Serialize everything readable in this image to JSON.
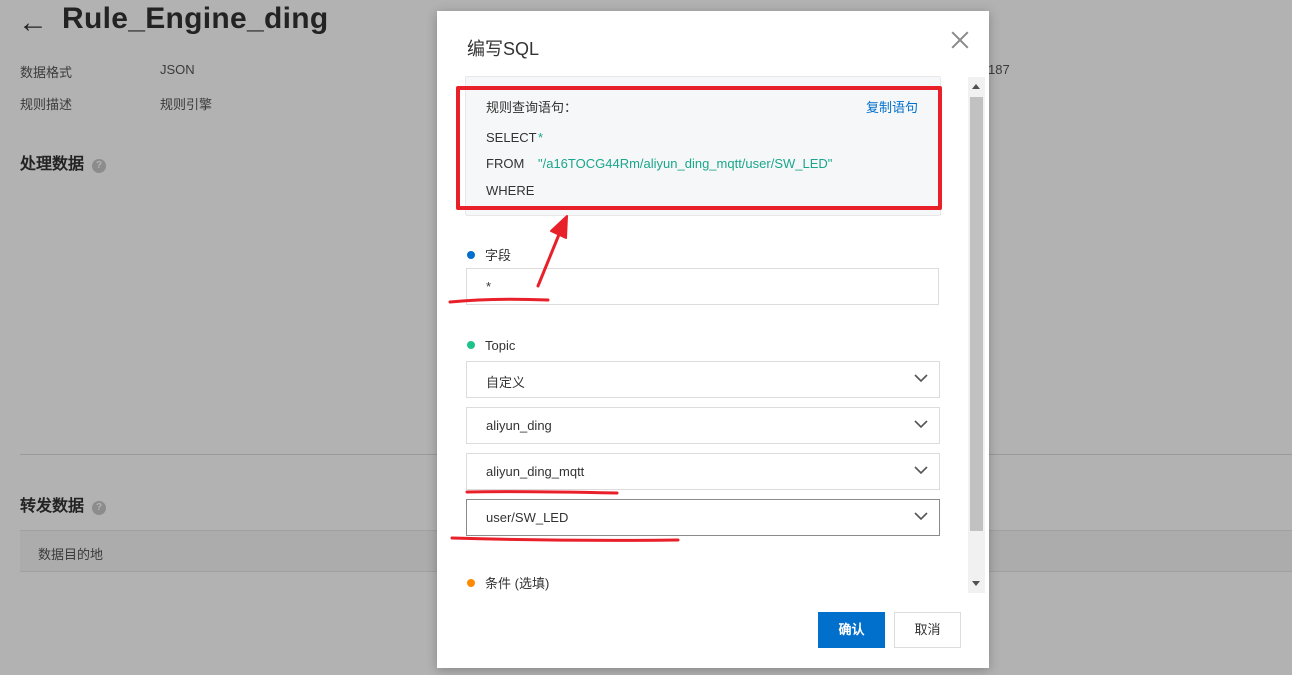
{
  "page": {
    "title": "Rule_Engine_ding",
    "info": [
      {
        "label": "数据格式",
        "value": "JSON"
      },
      {
        "label": "规则描述",
        "value": "规则引擎"
      }
    ],
    "right_fragment": "187",
    "sections": {
      "process": "处理数据",
      "forward": "转发数据"
    },
    "destination_header": "数据目的地"
  },
  "modal": {
    "title": "编写SQL",
    "sql": {
      "label": "规则查询语句：",
      "copy_label": "复制语句",
      "select_kw": "SELECT",
      "select_val": "*",
      "from_kw": "FROM",
      "from_val": "\"/a16TOCG44Rm/aliyun_ding_mqtt/user/SW_LED\"",
      "where_kw": "WHERE"
    },
    "field_label": "字段",
    "field_value": "*",
    "topic_label": "Topic",
    "topic_selects": [
      "自定义",
      "aliyun_ding",
      "aliyun_ding_mqtt",
      "user/SW_LED"
    ],
    "condition_label": "条件 (选填)",
    "confirm_label": "确认",
    "cancel_label": "取消"
  },
  "colors": {
    "primary": "#0070cc",
    "sql_string": "#1aa68c",
    "annotation": "#e8202a",
    "dot_field": "#0070cc",
    "dot_topic": "#1ec28b",
    "dot_condition": "#ff8a00"
  }
}
